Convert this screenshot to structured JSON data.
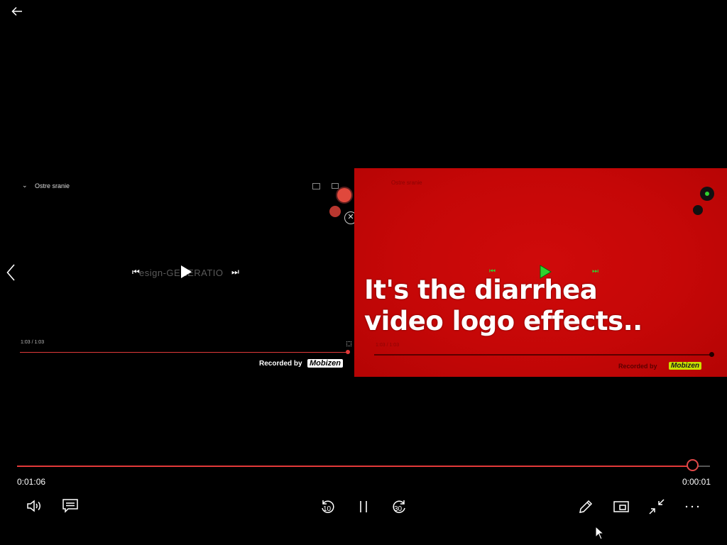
{
  "player": {
    "elapsed": "0:01:06",
    "remaining": "0:00:01",
    "progress_fraction": 0.976,
    "skip_back_seconds": "10",
    "skip_forward_seconds": "30"
  },
  "left_video": {
    "title": "Ostre sranie",
    "center_text": "esign-GENERATIO",
    "time": "1:03 / 1:03",
    "watermark_prefix": "Recorded by",
    "watermark_brand": "Mobizen"
  },
  "overlay": {
    "caption_line1": "It's the diarrhea",
    "caption_line2": "video logo effects..",
    "top_label": "Ostre sranie",
    "bottom_time": "1:03 / 1:03",
    "watermark_prefix": "Recorded by",
    "watermark_brand": "Mobizen",
    "background_color": "#c50707",
    "play_color": "#2fd42f"
  },
  "accent_color": "#e23a3a"
}
